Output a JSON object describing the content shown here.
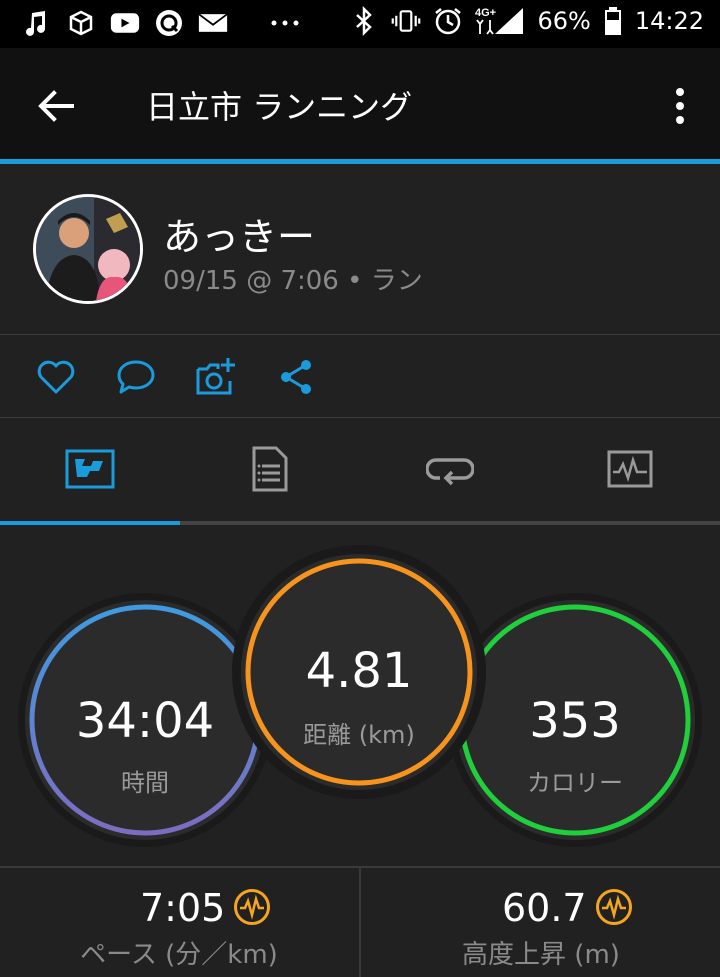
{
  "status_bar": {
    "left_icons": [
      "music-note-icon",
      "box-icon",
      "youtube-icon",
      "q-icon",
      "mail-icon",
      "more-dots-icon"
    ],
    "battery_percent": "66%",
    "network": "4G+",
    "time": "14:22"
  },
  "app_bar": {
    "title": "日立市 ランニング"
  },
  "activity": {
    "user_name": "あっきー",
    "meta": "09/15 @ 7:06 • ラン"
  },
  "actions": [
    "heart-icon",
    "comment-icon",
    "add-photo-icon",
    "share-icon"
  ],
  "tabs": [
    {
      "name": "overview",
      "icon": "map-overview-icon",
      "active": true
    },
    {
      "name": "details",
      "icon": "document-list-icon",
      "active": false
    },
    {
      "name": "laps",
      "icon": "loop-icon",
      "active": false
    },
    {
      "name": "charts",
      "icon": "chart-icon",
      "active": false
    }
  ],
  "metrics": {
    "time": {
      "value": "34:04",
      "label": "時間"
    },
    "distance": {
      "value": "4.81",
      "label": "距離 (km)"
    },
    "calories": {
      "value": "353",
      "label": "カロリー"
    }
  },
  "stats": {
    "pace": {
      "value": "7:05",
      "label": "ペース (分／km)"
    },
    "elevation": {
      "value": "60.7",
      "label": "高度上昇 (m)"
    }
  },
  "colors": {
    "accent": "#1a9bdb",
    "time_ring_start": "#3f9be0",
    "time_ring_end": "#7d6cc0",
    "distance_ring": "#f7941d",
    "calories_ring": "#1fcf3c",
    "pulse_icon": "#f7a51d"
  }
}
